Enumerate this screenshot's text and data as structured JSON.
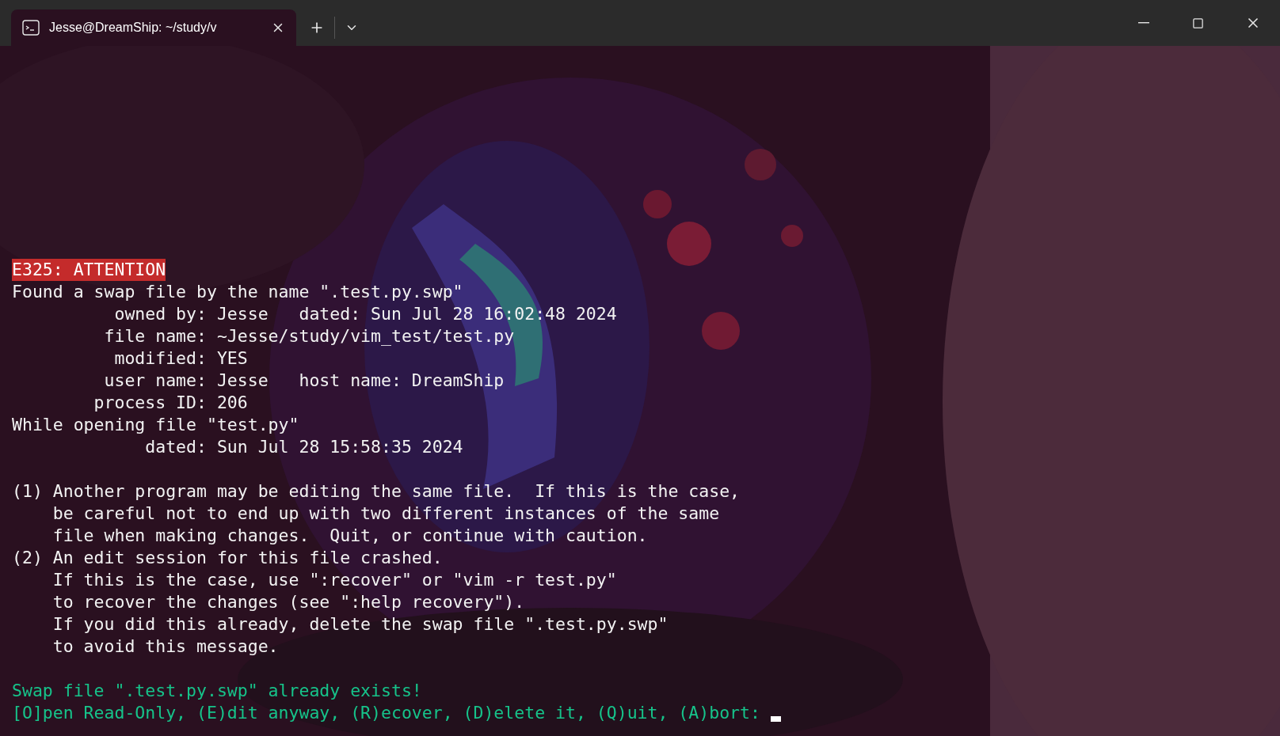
{
  "tab": {
    "title": "Jesse@DreamShip: ~/study/v",
    "selected": true
  },
  "terminal": {
    "lines": [
      {
        "kind": "error",
        "text": "E325: ATTENTION"
      },
      {
        "kind": "normal",
        "text": "Found a swap file by the name \".test.py.swp\""
      },
      {
        "kind": "normal",
        "text": "          owned by: Jesse   dated: Sun Jul 28 16:02:48 2024"
      },
      {
        "kind": "normal",
        "text": "         file name: ~Jesse/study/vim_test/test.py"
      },
      {
        "kind": "normal",
        "text": "          modified: YES"
      },
      {
        "kind": "normal",
        "text": "         user name: Jesse   host name: DreamShip"
      },
      {
        "kind": "normal",
        "text": "        process ID: 206"
      },
      {
        "kind": "normal",
        "text": "While opening file \"test.py\""
      },
      {
        "kind": "normal",
        "text": "             dated: Sun Jul 28 15:58:35 2024"
      },
      {
        "kind": "blank"
      },
      {
        "kind": "normal",
        "text": "(1) Another program may be editing the same file.  If this is the case,"
      },
      {
        "kind": "normal",
        "text": "    be careful not to end up with two different instances of the same"
      },
      {
        "kind": "normal",
        "text": "    file when making changes.  Quit, or continue with caution."
      },
      {
        "kind": "normal",
        "text": "(2) An edit session for this file crashed."
      },
      {
        "kind": "normal",
        "text": "    If this is the case, use \":recover\" or \"vim -r test.py\""
      },
      {
        "kind": "normal",
        "text": "    to recover the changes (see \":help recovery\")."
      },
      {
        "kind": "normal",
        "text": "    If you did this already, delete the swap file \".test.py.swp\""
      },
      {
        "kind": "normal",
        "text": "    to avoid this message."
      },
      {
        "kind": "blank"
      },
      {
        "kind": "prompt",
        "text": "Swap file \".test.py.swp\" already exists!"
      },
      {
        "kind": "prompt",
        "text": "[O]pen Read-Only, (E)dit anyway, (R)ecover, (D)elete it, (Q)uit, (A)bort: ",
        "cursor": true
      }
    ]
  }
}
